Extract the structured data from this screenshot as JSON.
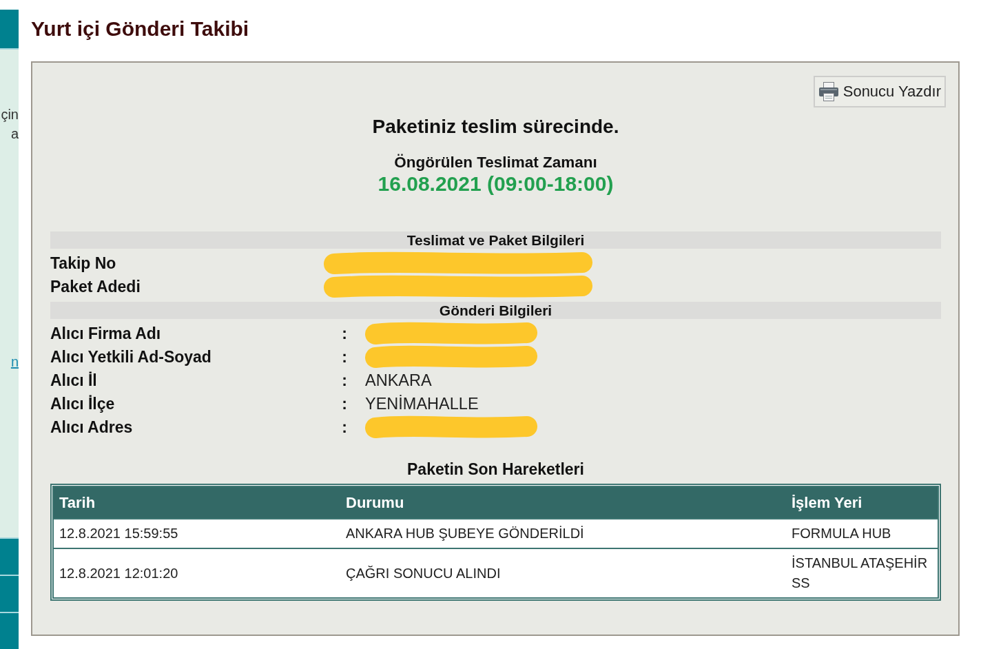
{
  "sidebar": {
    "text_fragments": [
      "çin",
      "a"
    ],
    "link": "n"
  },
  "page_title": "Yurt içi Gönderi Takibi",
  "print_button": {
    "label": "Sonucu Yazdır"
  },
  "status": "Paketiniz teslim sürecinde.",
  "estimated_delivery": {
    "label": "Öngörülen Teslimat Zamanı",
    "value": "16.08.2021 (09:00-18:00)"
  },
  "sections": [
    {
      "title": "Teslimat ve Paket Bilgileri",
      "rows": [
        {
          "label": "Takip No",
          "redacted": true
        },
        {
          "label": "Paket Adedi",
          "redacted": true
        }
      ]
    },
    {
      "title": "Gönderi Bilgileri",
      "rows": [
        {
          "label": "Alıcı Firma Adı",
          "separator": ":",
          "redacted": true
        },
        {
          "label": "Alıcı Yetkili Ad-Soyad",
          "separator": ":",
          "redacted": true
        },
        {
          "label": "Alıcı İl",
          "separator": ":",
          "value": "ANKARA",
          "redacted": false
        },
        {
          "label": "Alıcı İlçe",
          "separator": ":",
          "value": "YENİMAHALLE",
          "redacted": false
        },
        {
          "label": "Alıcı Adres",
          "separator": ":",
          "redacted": true
        }
      ]
    }
  ],
  "movements": {
    "title": "Paketin Son Hareketleri",
    "columns": [
      "Tarih",
      "Durumu",
      "İşlem Yeri"
    ],
    "rows": [
      [
        "12.8.2021 15:59:55",
        "ANKARA HUB ŞUBEYE GÖNDERİLDİ",
        "FORMULA HUB"
      ],
      [
        "12.8.2021 12:01:20",
        "ÇAĞRI SONUCU ALINDI",
        "İSTANBUL ATAŞEHİR SS"
      ]
    ]
  }
}
